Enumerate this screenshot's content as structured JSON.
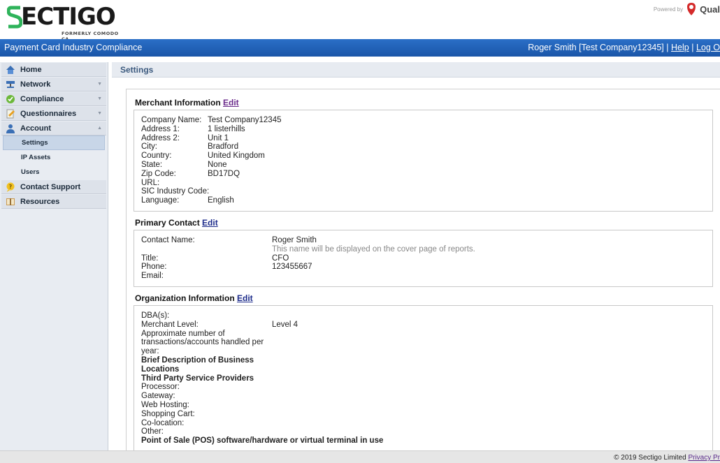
{
  "header": {
    "logo_text": "ECTIGO",
    "logo_sub": "FORMERLY COMODO CA",
    "powered_by": "Powered by",
    "partner": "Qual"
  },
  "navbar": {
    "title": "Payment Card Industry Compliance",
    "user": "Roger Smith [Test Company12345]",
    "sep1": "|",
    "help": "Help",
    "sep2": "|",
    "logout": "Log O"
  },
  "sidebar": {
    "items": [
      {
        "label": "Home",
        "icon": "home-icon"
      },
      {
        "label": "Network",
        "icon": "network-icon"
      },
      {
        "label": "Compliance",
        "icon": "compliance-icon"
      },
      {
        "label": "Questionnaires",
        "icon": "questionnaire-icon"
      },
      {
        "label": "Account",
        "icon": "account-icon"
      }
    ],
    "sub_items": [
      "Settings",
      "IP Assets",
      "Users"
    ],
    "items2": [
      {
        "label": "Contact Support",
        "icon": "support-icon"
      },
      {
        "label": "Resources",
        "icon": "book-icon"
      }
    ]
  },
  "page": {
    "title": "Settings"
  },
  "merchant": {
    "title": "Merchant Information",
    "edit": "Edit",
    "rows": [
      {
        "label": "Company Name:",
        "value": "Test Company12345"
      },
      {
        "label": "Address 1:",
        "value": "1 listerhills"
      },
      {
        "label": "Address 2:",
        "value": "Unit 1"
      },
      {
        "label": "City:",
        "value": "Bradford"
      },
      {
        "label": "Country:",
        "value": "United Kingdom"
      },
      {
        "label": "State:",
        "value": "None"
      },
      {
        "label": "Zip Code:",
        "value": "BD17DQ"
      },
      {
        "label": "URL:",
        "value": ""
      },
      {
        "label": "SIC Industry Code:",
        "value": ""
      },
      {
        "label": "Language:",
        "value": "English"
      }
    ]
  },
  "contact": {
    "title": "Primary Contact",
    "edit": "Edit",
    "name_label": "Contact Name:",
    "name_value": "Roger Smith",
    "hint": "This name will be displayed on the cover page of reports.",
    "title_label": "Title:",
    "title_value": "CFO",
    "phone_label": "Phone:",
    "phone_value": "123455667",
    "email_label": "Email:",
    "email_value": ""
  },
  "org": {
    "title": "Organization Information",
    "edit": "Edit",
    "dba": "DBA(s):",
    "level_label": "Merchant Level:",
    "level_value": "Level 4",
    "approx1": "Approximate number of",
    "approx2": "transactions/accounts handled per",
    "approx3": "year:",
    "brief1": "Brief Description of Business",
    "brief2": "Locations",
    "third": "Third Party Service Providers",
    "processor": "Processor:",
    "gateway": "Gateway:",
    "hosting": "Web Hosting:",
    "cart": "Shopping Cart:",
    "colo": "Co-location:",
    "other": "Other:",
    "pos": "Point of Sale (POS) software/hardware or virtual terminal in use"
  },
  "footer": {
    "copyright": "© 2019 Sectigo Limited",
    "privacy": "Privacy Pr"
  }
}
